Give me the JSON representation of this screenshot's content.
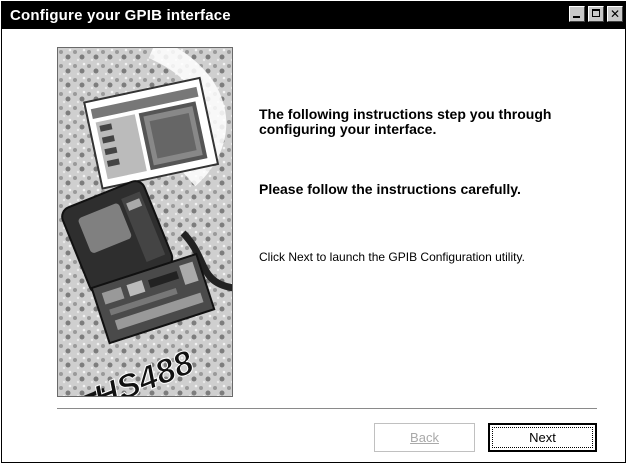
{
  "window": {
    "title": "Configure your GPIB interface"
  },
  "content": {
    "intro": "The following instructions step you through configuring your interface.",
    "warning": "Please follow the instructions carefully.",
    "hint": "Click Next to launch the GPIB Configuration utility."
  },
  "picture": {
    "brand_text": "HS488"
  },
  "buttons": {
    "back_label": "Back",
    "next_label": "Next"
  },
  "icons": [
    "minimize-icon",
    "maximize-icon",
    "close-icon"
  ]
}
